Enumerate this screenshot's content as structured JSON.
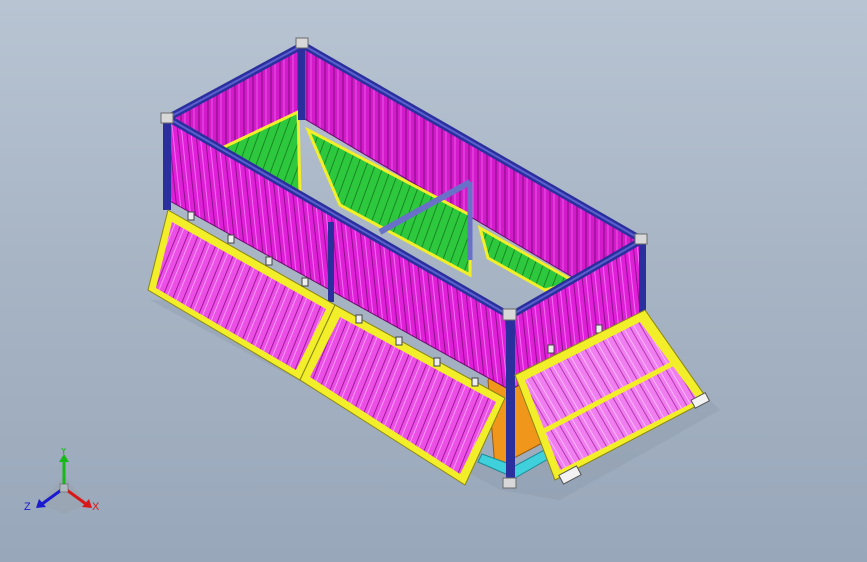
{
  "viewport": {
    "background_top": "#b8c4d2",
    "background_bottom": "#98a7ba"
  },
  "model": {
    "colors": {
      "frame": "#2b2f9e",
      "frame_light": "#5a5fd0",
      "wall": "#e020d8",
      "wall_dark": "#a814a4",
      "wall_rib": "#7a0f78",
      "door_panel": "#f07ef0",
      "door_frame": "#f2ee2a",
      "floor_hatch": "#28c83a",
      "floor_hatch_dark": "#168a22",
      "chute": "#f0961a",
      "base": "#3fd0dc",
      "corner": "#d8d8d8"
    }
  },
  "triad": {
    "axis_y": "Y",
    "axis_z": "Z",
    "axis_x": "X",
    "color_y": "#18b818",
    "color_z": "#1a1ad0",
    "color_x": "#d81818"
  }
}
